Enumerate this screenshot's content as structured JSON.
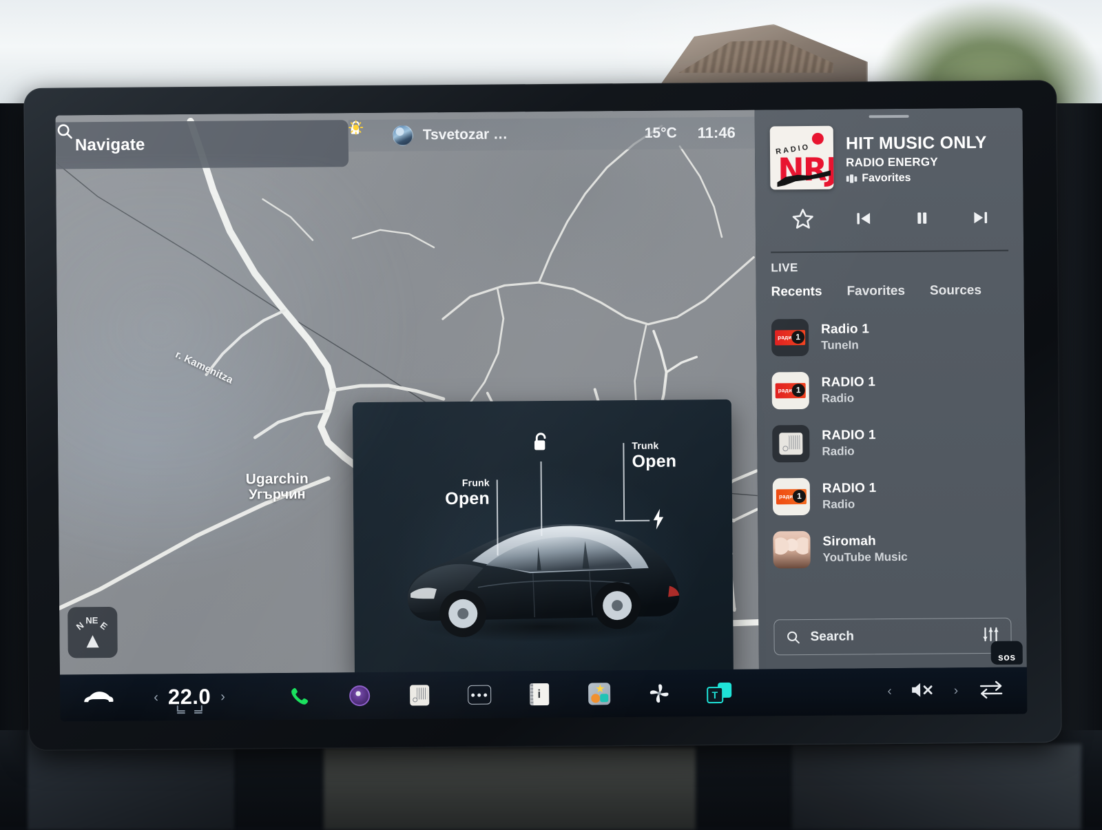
{
  "map": {
    "search": {
      "placeholder": "Navigate",
      "icon": "search-icon"
    },
    "labels": {
      "river": "r. Kamenitza",
      "town_latin": "Ugarchin",
      "town_cyrillic": "Угърчин"
    },
    "compass": {
      "n": "N",
      "ne": "NE",
      "e": "E",
      "icon": "compass-arrow-icon"
    }
  },
  "statusbar": {
    "lock_icon": "unlocked-padlock-icon",
    "profile_name": "Tsvetozar …",
    "avatar_icon": "user-avatar",
    "weather_icon": "sun-icon",
    "temperature": "15°C",
    "clock": "11:46"
  },
  "car_card": {
    "lock": {
      "label": "",
      "icon": "unlocked-padlock-icon"
    },
    "frunk": {
      "title": "Frunk",
      "value": "Open"
    },
    "trunk": {
      "title": "Trunk",
      "value": "Open"
    },
    "charge_port": {
      "icon": "charge-bolt-icon"
    },
    "vehicle_icon": "tesla-model-s-render"
  },
  "media": {
    "now_playing": {
      "title": "HIT MUSIC ONLY",
      "subtitle": "RADIO ENERGY",
      "source": "Favorites",
      "source_icon": "favorites-icon",
      "artwork": {
        "brand": "NRJ",
        "radio_word": "RADIO"
      }
    },
    "transport": {
      "favorite": "star-icon",
      "previous": "skip-previous-icon",
      "play_pause": "pause-icon",
      "next": "skip-next-icon"
    },
    "live_label": "LIVE",
    "tabs": [
      {
        "label": "Recents",
        "active": true
      },
      {
        "label": "Favorites",
        "active": false
      },
      {
        "label": "Sources",
        "active": false
      }
    ],
    "items": [
      {
        "title": "Radio 1",
        "subtitle": "TuneIn",
        "thumb": "radio1-dark-thumb"
      },
      {
        "title": "RADIO 1",
        "subtitle": "Radio",
        "thumb": "radio1-light-thumb"
      },
      {
        "title": "RADIO 1",
        "subtitle": "Radio",
        "thumb": "tuner-dark-thumb"
      },
      {
        "title": "RADIO 1",
        "subtitle": "Radio",
        "thumb": "radio1-orange-thumb"
      },
      {
        "title": "Siromah",
        "subtitle": "YouTube Music",
        "thumb": "siromah-album-thumb"
      }
    ],
    "search": {
      "placeholder": "Search",
      "icon": "search-icon",
      "equalizer_icon": "equalizer-icon"
    },
    "sos": "sos"
  },
  "taskbar": {
    "car_icon": "car-icon",
    "climate": {
      "decrease": "‹",
      "temperature": "22.0",
      "increase": "›",
      "seat_left_icon": "seat-heater-icon",
      "seat_right_icon": "seat-heater-icon"
    },
    "apps": [
      {
        "name": "phone-app",
        "icon": "phone-icon"
      },
      {
        "name": "camera-app",
        "icon": "camera-icon"
      },
      {
        "name": "tuner-app",
        "icon": "radio-tuner-icon"
      },
      {
        "name": "more-app",
        "icon": "ellipsis-icon"
      },
      {
        "name": "notes-app",
        "icon": "notes-icon"
      },
      {
        "name": "toybox-app",
        "icon": "apps-grid-icon"
      },
      {
        "name": "climate-app",
        "icon": "fan-icon"
      },
      {
        "name": "theater-app",
        "icon": "theater-icon"
      }
    ],
    "volume": {
      "decrease": "‹",
      "icon": "volume-muted-icon",
      "increase": "›"
    },
    "swap_icon": "swap-arrows-icon"
  },
  "colors": {
    "media_panel": "#545b63",
    "map_base": "#8e9297",
    "road": "#f2f3f0",
    "taskbar": "#091019",
    "accent_green": "#15e05a",
    "accent_teal": "#1fe3d8",
    "nrj_red": "#e8112d"
  }
}
